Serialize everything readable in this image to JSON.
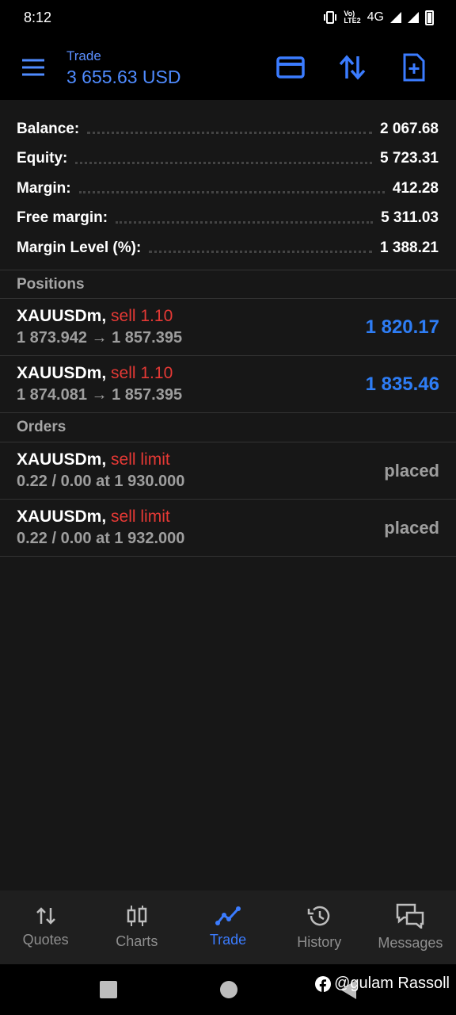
{
  "status_bar": {
    "time": "8:12",
    "network": "4G"
  },
  "app_bar": {
    "title": "Trade",
    "subtitle": "3 655.63 USD"
  },
  "summary": [
    {
      "label": "Balance:",
      "value": "2 067.68"
    },
    {
      "label": "Equity:",
      "value": "5 723.31"
    },
    {
      "label": "Margin:",
      "value": "412.28"
    },
    {
      "label": "Free margin:",
      "value": "5 311.03"
    },
    {
      "label": "Margin Level (%):",
      "value": "1 388.21"
    }
  ],
  "positions": {
    "header": "Positions",
    "items": [
      {
        "symbol": "XAUUSDm,",
        "side": "sell 1.10",
        "detail": "1 873.942 → 1 857.395",
        "profit": "1 820.17"
      },
      {
        "symbol": "XAUUSDm,",
        "side": "sell 1.10",
        "detail": "1 874.081 → 1 857.395",
        "profit": "1 835.46"
      }
    ]
  },
  "orders": {
    "header": "Orders",
    "items": [
      {
        "symbol": "XAUUSDm,",
        "side": "sell limit",
        "detail": "0.22 / 0.00 at 1 930.000",
        "status": "placed"
      },
      {
        "symbol": "XAUUSDm,",
        "side": "sell limit",
        "detail": "0.22 / 0.00 at 1 932.000",
        "status": "placed"
      }
    ]
  },
  "bottom_nav": [
    {
      "label": "Quotes",
      "icon": "quotes-icon"
    },
    {
      "label": "Charts",
      "icon": "charts-icon"
    },
    {
      "label": "Trade",
      "icon": "trade-icon",
      "active": true
    },
    {
      "label": "History",
      "icon": "history-icon"
    },
    {
      "label": "Messages",
      "icon": "messages-icon"
    }
  ],
  "watermark": "@gulam Rassoll",
  "colors": {
    "accent": "#3b7cff",
    "sell": "#e53935",
    "profit": "#2e7df5"
  }
}
